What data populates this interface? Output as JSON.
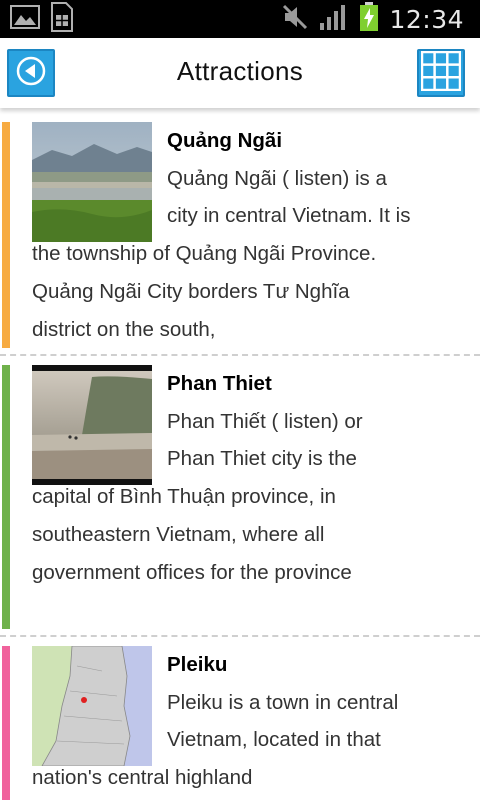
{
  "status_bar": {
    "time": "12:34",
    "left_icons": [
      "gallery-icon",
      "sim-card-icon"
    ],
    "right_icons": [
      "muted-speaker-icon",
      "signal-icon",
      "battery-charging-icon"
    ]
  },
  "action_bar": {
    "title": "Attractions",
    "back_icon": "back-arrow-icon",
    "grid_icon": "grid-icon",
    "accent": "#2aa3e0"
  },
  "attractions": [
    {
      "title": "Quảng Ngãi",
      "description": "Quảng Ngãi ( listen) is a city in central Vietnam. It is the township of Quảng Ngãi Province. Quảng Ngãi City borders Tư Nghĩa district on the south,",
      "stripe_color": "#f7ab42"
    },
    {
      "title": "Phan Thiet",
      "description": "Phan Thiết ( listen) or Phan Thiet city is the capital of Bình Thuận province, in southeastern Vietnam, where all government offices for the province",
      "stripe_color": "#6fb14b"
    },
    {
      "title": "Pleiku",
      "description": "Pleiku is a town in central Vietnam, located in that nation's central highland",
      "stripe_color": "#f0629c"
    }
  ]
}
